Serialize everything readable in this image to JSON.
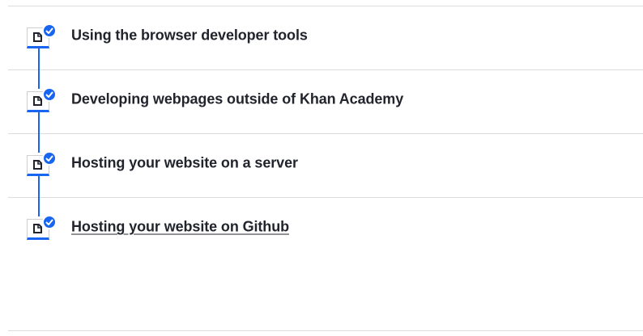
{
  "colors": {
    "accent": "#1865f2",
    "text": "#21242c",
    "divider": "#dcdcdc"
  },
  "items": [
    {
      "label": "Using the browser developer tools",
      "icon": "article-icon",
      "status": "complete-check-icon",
      "hovered": false
    },
    {
      "label": "Developing webpages outside of Khan Academy",
      "icon": "article-icon",
      "status": "complete-check-icon",
      "hovered": false
    },
    {
      "label": "Hosting your website on a server",
      "icon": "article-icon",
      "status": "complete-check-icon",
      "hovered": false
    },
    {
      "label": "Hosting your website on Github",
      "icon": "article-icon",
      "status": "complete-check-icon",
      "hovered": true
    }
  ]
}
